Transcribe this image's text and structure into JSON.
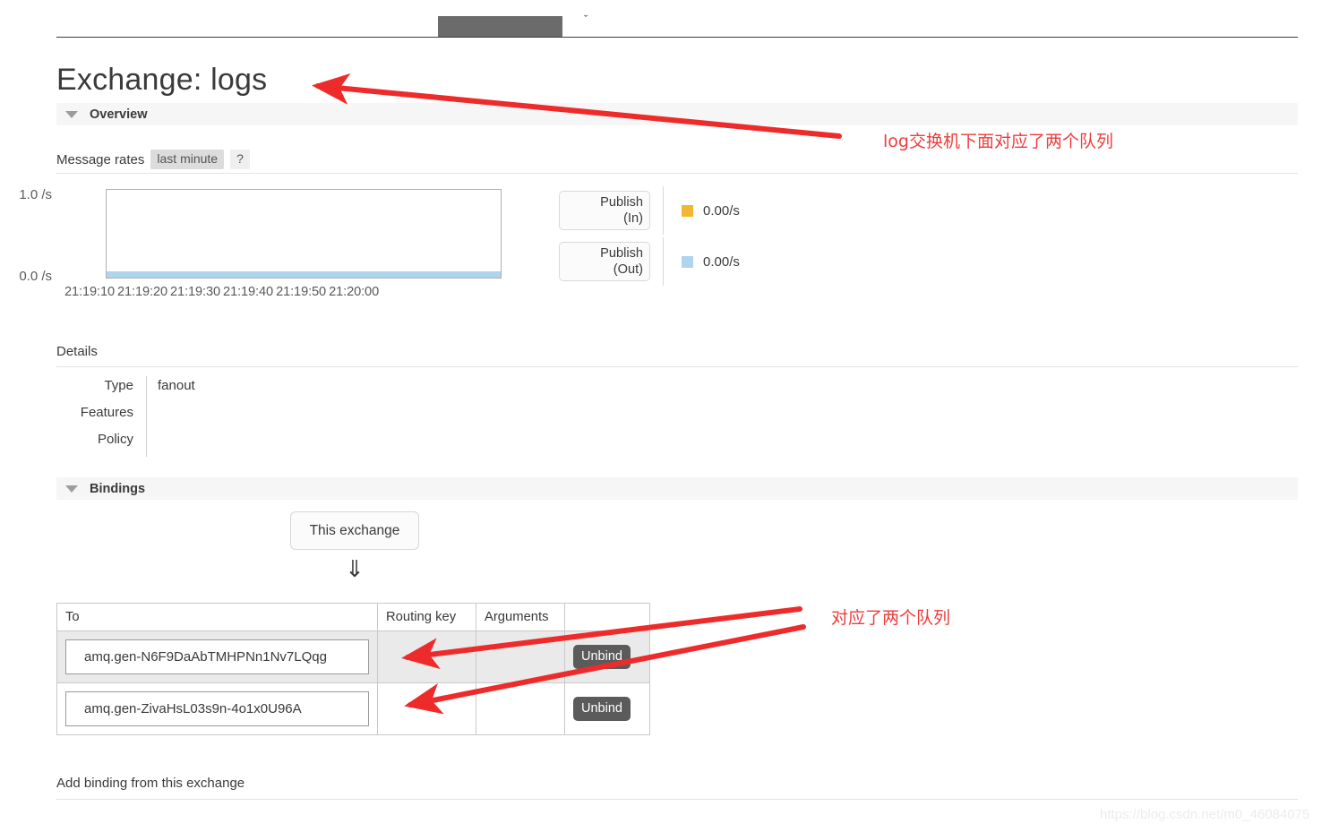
{
  "topnav": {
    "active_tab_glyph": "s",
    "next_tab_glyph": "ˇ"
  },
  "page_title": "Exchange: logs",
  "sections": {
    "overview": {
      "label": "Overview",
      "toggle_icon": "triangle-down-icon"
    },
    "bindings": {
      "label": "Bindings",
      "toggle_icon": "triangle-down-icon"
    }
  },
  "message_rates": {
    "label": "Message rates",
    "period_chip": "last minute",
    "help_chip": "?"
  },
  "chart_data": {
    "type": "line",
    "title": "Message rates",
    "xlabel": "",
    "ylabel": "",
    "ylim": [
      0.0,
      1.0
    ],
    "y_ticks": [
      "0.0 /s",
      "1.0 /s"
    ],
    "x": [
      "21:19:10",
      "21:19:20",
      "21:19:30",
      "21:19:40",
      "21:19:50",
      "21:20:00"
    ],
    "grid": false,
    "legend_position": "right",
    "series": [
      {
        "name": "Publish (In)",
        "color": "#f2b632",
        "rate": "0.00/s",
        "values": [
          0,
          0,
          0,
          0,
          0,
          0
        ]
      },
      {
        "name": "Publish (Out)",
        "color": "#aed4ee",
        "rate": "0.00/s",
        "values": [
          0,
          0,
          0,
          0,
          0,
          0
        ]
      }
    ]
  },
  "legend": [
    {
      "line1": "Publish",
      "line2": "(In)",
      "color": "#f2b632",
      "value": "0.00/s"
    },
    {
      "line1": "Publish",
      "line2": "(Out)",
      "color": "#aed4ee",
      "value": "0.00/s"
    }
  ],
  "details": {
    "title": "Details",
    "rows": [
      {
        "key": "Type",
        "value": "fanout"
      },
      {
        "key": "Features",
        "value": ""
      },
      {
        "key": "Policy",
        "value": ""
      }
    ]
  },
  "bindings": {
    "this_exchange_label": "This exchange",
    "flow_arrow": "⇓",
    "columns": [
      "To",
      "Routing key",
      "Arguments",
      ""
    ],
    "rows": [
      {
        "to": "amq.gen-N6F9DaAbTMHPNn1Nv7LQqg",
        "routing_key": "",
        "arguments": "",
        "action": "Unbind"
      },
      {
        "to": "amq.gen-ZivaHsL03s9n-4o1x0U96A",
        "routing_key": "",
        "arguments": "",
        "action": "Unbind"
      }
    ],
    "add_binding_label": "Add binding from this exchange"
  },
  "annotations": {
    "accent_color": "#ef3b3b",
    "note_top": "log交换机下面对应了两个队列",
    "note_bottom": "对应了两个队列"
  },
  "watermark": "https://blog.csdn.net/m0_46084075"
}
